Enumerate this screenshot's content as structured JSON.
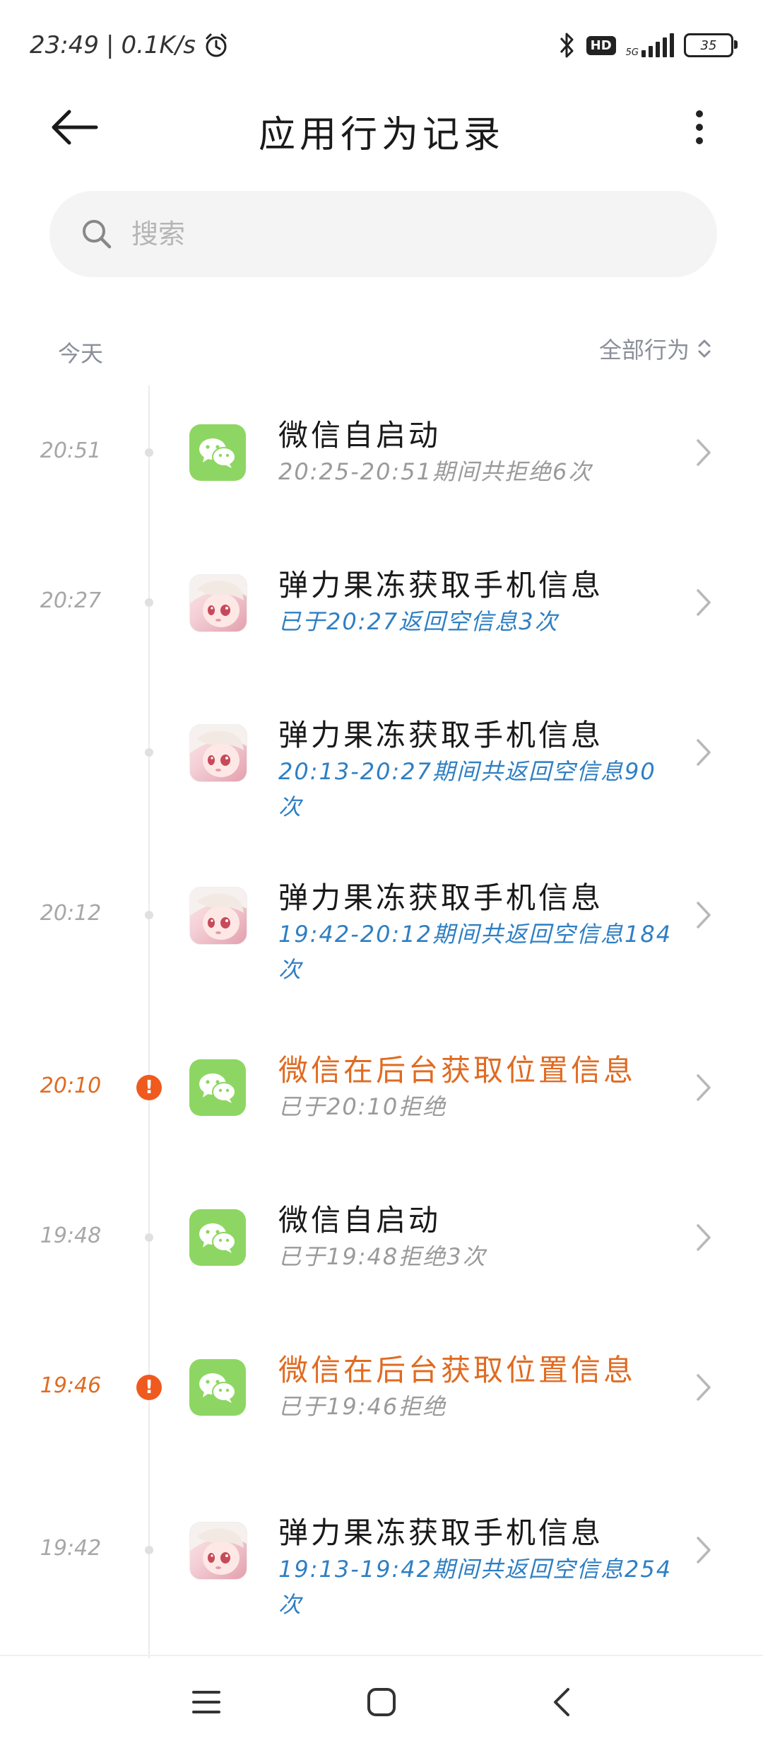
{
  "status_bar": {
    "time": "23:49",
    "speed": "0.1K/s",
    "network_label": "5G",
    "hd_label": "HD",
    "battery": "35"
  },
  "header": {
    "title": "应用行为记录"
  },
  "search": {
    "placeholder": "搜索"
  },
  "section": {
    "today": "今天",
    "filter_label": "全部行为"
  },
  "records": [
    {
      "time": "20:51",
      "app": "wechat",
      "alert": false,
      "title": "微信自启动",
      "subtitle": "20:25-20:51期间共拒绝6次",
      "sub_color": "gray"
    },
    {
      "time": "20:27",
      "app": "jelly",
      "alert": false,
      "title": "弹力果冻获取手机信息",
      "subtitle": "已于20:27返回空信息3次",
      "sub_color": "blue"
    },
    {
      "time": "",
      "app": "jelly",
      "alert": false,
      "title": "弹力果冻获取手机信息",
      "subtitle": "20:13-20:27期间共返回空信息90次",
      "sub_color": "blue"
    },
    {
      "time": "20:12",
      "app": "jelly",
      "alert": false,
      "title": "弹力果冻获取手机信息",
      "subtitle": "19:42-20:12期间共返回空信息184次",
      "sub_color": "blue"
    },
    {
      "time": "20:10",
      "app": "wechat",
      "alert": true,
      "title": "微信在后台获取位置信息",
      "subtitle": "已于20:10拒绝",
      "sub_color": "gray"
    },
    {
      "time": "19:48",
      "app": "wechat",
      "alert": false,
      "title": "微信自启动",
      "subtitle": "已于19:48拒绝3次",
      "sub_color": "gray"
    },
    {
      "time": "19:46",
      "app": "wechat",
      "alert": true,
      "title": "微信在后台获取位置信息",
      "subtitle": "已于19:46拒绝",
      "sub_color": "gray"
    },
    {
      "time": "19:42",
      "app": "jelly",
      "alert": false,
      "title": "弹力果冻获取手机信息",
      "subtitle": "19:13-19:42期间共返回空信息254次",
      "sub_color": "blue"
    }
  ],
  "colors": {
    "alert": "#e06b22",
    "link_blue": "#2f7fc3",
    "wechat_green": "#8ed663"
  }
}
